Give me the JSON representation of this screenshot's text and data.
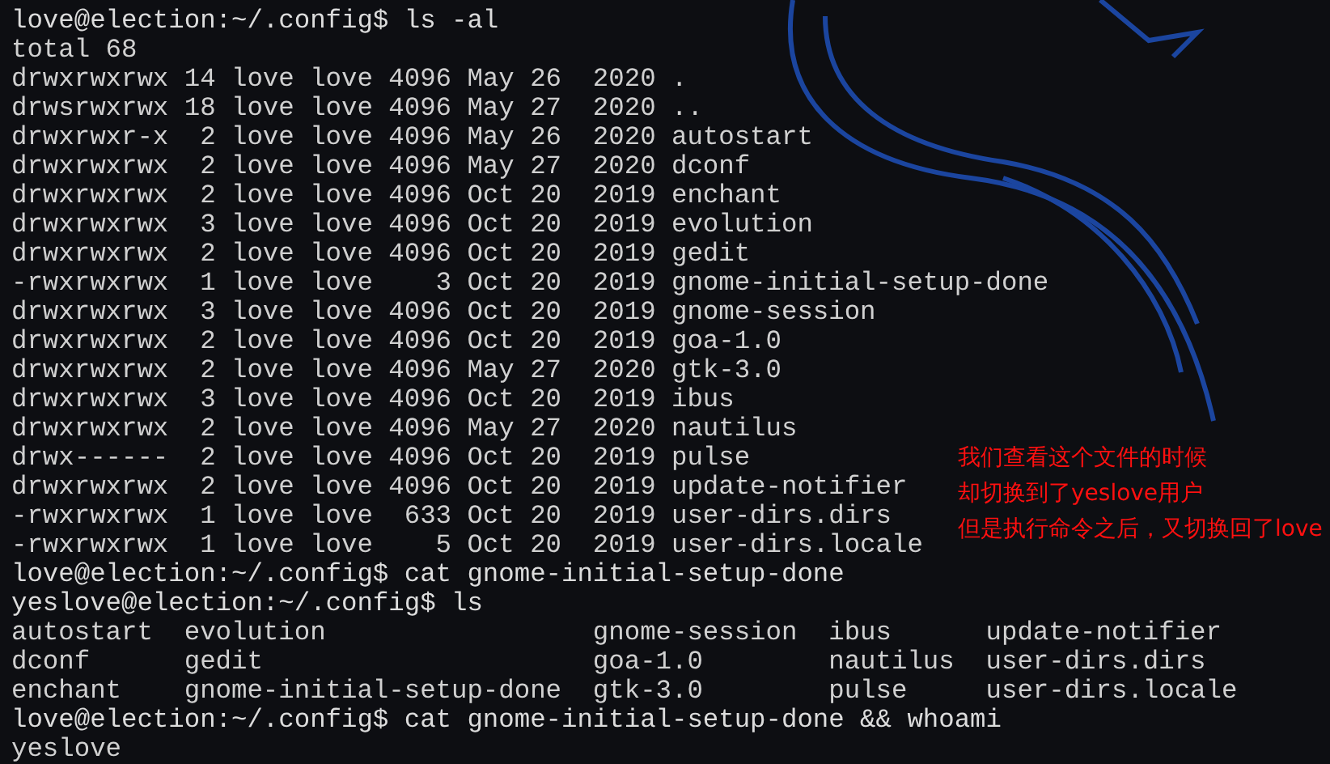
{
  "terminal": {
    "lines": [
      {
        "kind": "prompt",
        "text": "love@election:~/.config$ ls -al"
      },
      {
        "kind": "output",
        "text": "total 68"
      },
      {
        "kind": "output",
        "text": "drwxrwxrwx 14 love love 4096 May 26  2020 ."
      },
      {
        "kind": "output",
        "text": "drwsrwxrwx 18 love love 4096 May 27  2020 .."
      },
      {
        "kind": "output",
        "text": "drwxrwxr-x  2 love love 4096 May 26  2020 autostart"
      },
      {
        "kind": "output",
        "text": "drwxrwxrwx  2 love love 4096 May 27  2020 dconf"
      },
      {
        "kind": "output",
        "text": "drwxrwxrwx  2 love love 4096 Oct 20  2019 enchant"
      },
      {
        "kind": "output",
        "text": "drwxrwxrwx  3 love love 4096 Oct 20  2019 evolution"
      },
      {
        "kind": "output",
        "text": "drwxrwxrwx  2 love love 4096 Oct 20  2019 gedit"
      },
      {
        "kind": "output",
        "text": "-rwxrwxrwx  1 love love    3 Oct 20  2019 gnome-initial-setup-done"
      },
      {
        "kind": "output",
        "text": "drwxrwxrwx  3 love love 4096 Oct 20  2019 gnome-session"
      },
      {
        "kind": "output",
        "text": "drwxrwxrwx  2 love love 4096 Oct 20  2019 goa-1.0"
      },
      {
        "kind": "output",
        "text": "drwxrwxrwx  2 love love 4096 May 27  2020 gtk-3.0"
      },
      {
        "kind": "output",
        "text": "drwxrwxrwx  3 love love 4096 Oct 20  2019 ibus"
      },
      {
        "kind": "output",
        "text": "drwxrwxrwx  2 love love 4096 May 27  2020 nautilus"
      },
      {
        "kind": "output",
        "text": "drwx------  2 love love 4096 Oct 20  2019 pulse"
      },
      {
        "kind": "output",
        "text": "drwxrwxrwx  2 love love 4096 Oct 20  2019 update-notifier"
      },
      {
        "kind": "output",
        "text": "-rwxrwxrwx  1 love love  633 Oct 20  2019 user-dirs.dirs"
      },
      {
        "kind": "output",
        "text": "-rwxrwxrwx  1 love love    5 Oct 20  2019 user-dirs.locale"
      },
      {
        "kind": "prompt",
        "text": "love@election:~/.config$ cat gnome-initial-setup-done"
      },
      {
        "kind": "prompt",
        "text": "yeslove@election:~/.config$ ls"
      },
      {
        "kind": "output",
        "text": "autostart  evolution                 gnome-session  ibus      update-notifier"
      },
      {
        "kind": "output",
        "text": "dconf      gedit                     goa-1.0        nautilus  user-dirs.dirs"
      },
      {
        "kind": "output",
        "text": "enchant    gnome-initial-setup-done  gtk-3.0        pulse     user-dirs.locale"
      },
      {
        "kind": "prompt",
        "text": "love@election:~/.config$ cat gnome-initial-setup-done && whoami"
      },
      {
        "kind": "output",
        "text": "yeslove"
      }
    ]
  },
  "annotation": {
    "lines": [
      "我们查看这个文件的时候",
      "却切换到了yeslove用户",
      "但是执行命令之后，又切换回了love"
    ]
  }
}
